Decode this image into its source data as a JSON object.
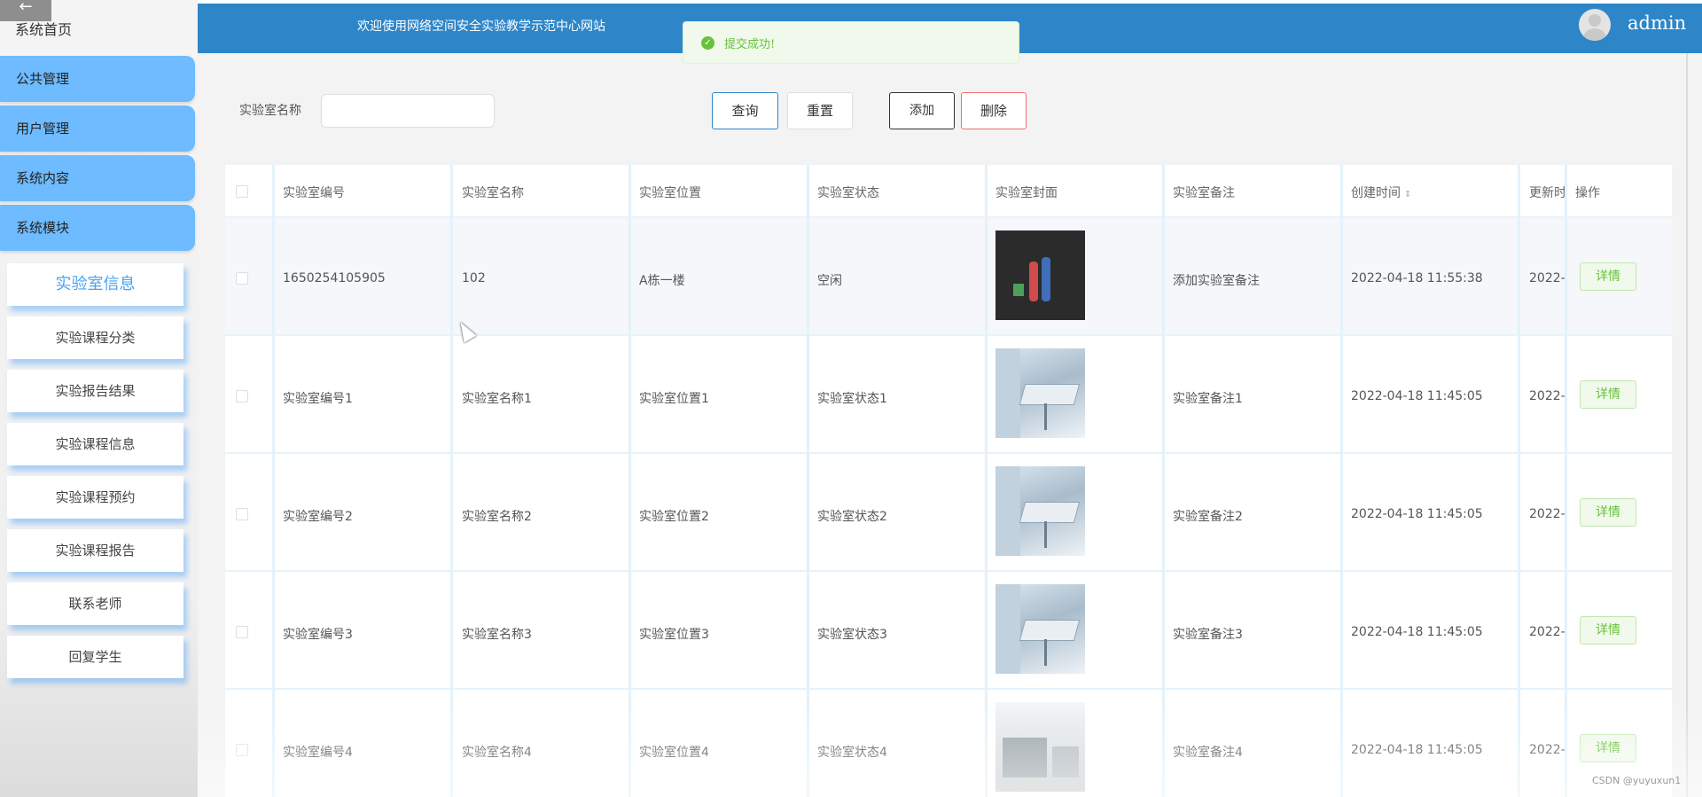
{
  "sidebar": {
    "back_glyph": "←",
    "home_label": "系统首页",
    "groups": [
      {
        "label": "公共管理"
      },
      {
        "label": "用户管理"
      },
      {
        "label": "系统内容"
      },
      {
        "label": "系统模块"
      }
    ],
    "sub_items": [
      {
        "label": "实验室信息",
        "active": true
      },
      {
        "label": "实验课程分类"
      },
      {
        "label": "实验报告结果"
      },
      {
        "label": "实验课程信息"
      },
      {
        "label": "实验课程预约"
      },
      {
        "label": "实验课程报告"
      },
      {
        "label": "联系老师"
      },
      {
        "label": "回复学生"
      }
    ]
  },
  "header": {
    "title": "欢迎使用网络空间安全实验教学示范中心网站",
    "username": "admin"
  },
  "toast": {
    "icon": "check-circle-icon",
    "message": "提交成功!"
  },
  "search": {
    "label": "实验室名称",
    "value": "",
    "query_label": "查询",
    "reset_label": "重置",
    "add_label": "添加",
    "delete_label": "删除"
  },
  "table": {
    "headers": [
      "实验室编号",
      "实验室名称",
      "实验室位置",
      "实验室状态",
      "实验室封面",
      "实验室备注",
      "创建时间",
      "更新时",
      "操作"
    ],
    "sort_glyph": "⇕",
    "detail_label": "详情",
    "rows": [
      {
        "code": "1650254105905",
        "name": "102",
        "location": "A栋一楼",
        "status": "空闲",
        "cover": "classroom-photo",
        "note": "添加实验室备注",
        "created": "2022-04-18 11:55:38",
        "updated": "2022-"
      },
      {
        "code": "实验室编号1",
        "name": "实验室名称1",
        "location": "实验室位置1",
        "status": "实验室状态1",
        "cover": "lab-photo",
        "note": "实验室备注1",
        "created": "2022-04-18 11:45:05",
        "updated": "2022-"
      },
      {
        "code": "实验室编号2",
        "name": "实验室名称2",
        "location": "实验室位置2",
        "status": "实验室状态2",
        "cover": "lab-photo",
        "note": "实验室备注2",
        "created": "2022-04-18 11:45:05",
        "updated": "2022-"
      },
      {
        "code": "实验室编号3",
        "name": "实验室名称3",
        "location": "实验室位置3",
        "status": "实验室状态3",
        "cover": "lab-photo",
        "note": "实验室备注3",
        "created": "2022-04-18 11:45:05",
        "updated": "2022-"
      },
      {
        "code": "实验室编号4",
        "name": "实验室名称4",
        "location": "实验室位置4",
        "status": "实验室状态4",
        "cover": "lab-photo-2",
        "note": "实验室备注4",
        "created": "2022-04-18 11:45:05",
        "updated": "2022-"
      }
    ]
  },
  "watermark": "CSDN @yuyuxun1",
  "colors": {
    "header_bg": "#2e86c9",
    "menu_group_bg": "#6ebbff",
    "active_sub_text": "#4aa3f0",
    "success": "#67c23a",
    "danger": "#f56c6c"
  }
}
